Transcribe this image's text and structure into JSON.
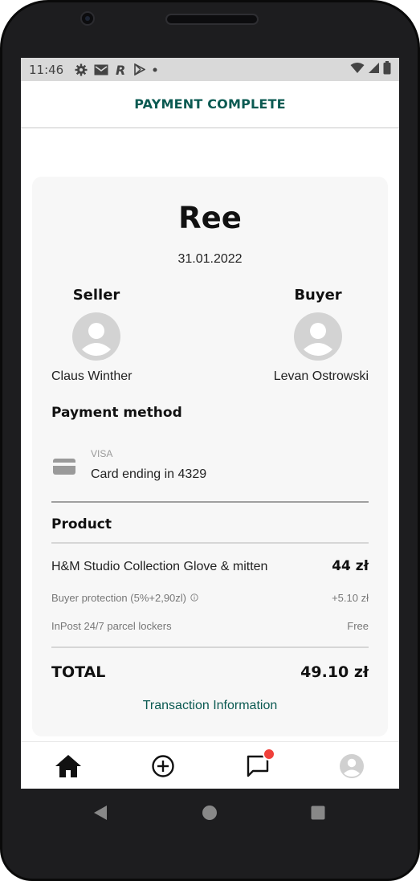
{
  "status_bar": {
    "time": "11:46",
    "icons": [
      "gear-icon",
      "gmail-icon",
      "r-app-icon",
      "play-store-icon",
      "dot-icon"
    ],
    "right_icons": [
      "wifi-icon",
      "signal-icon",
      "battery-icon"
    ]
  },
  "header": {
    "title": "PAYMENT COMPLETE"
  },
  "summary": {
    "store_name": "Ree",
    "date": "31.01.2022",
    "seller_label": "Seller",
    "seller_name": "Claus Winther",
    "buyer_label": "Buyer",
    "buyer_name": "Levan Ostrowski"
  },
  "payment": {
    "title": "Payment method",
    "card_brand": "VISA",
    "card_text": "Card ending in 4329",
    "icon": "credit-card-icon"
  },
  "product": {
    "title": "Product",
    "item_name": "H&M Studio Collection Glove & mitten",
    "item_price": "44 zł",
    "protection_label": "Buyer protection (5%+2,90zl)",
    "protection_value": "+5.10 zł",
    "shipping_label": "InPost 24/7 parcel lockers",
    "shipping_value": "Free"
  },
  "total": {
    "label": "TOTAL",
    "value": "49.10 zł"
  },
  "transaction_link": "Transaction Information",
  "bottom_nav": {
    "items": [
      "home-icon",
      "add-circle-icon",
      "chat-icon",
      "profile-icon"
    ],
    "chat_has_notification": true
  },
  "colors": {
    "accent": "#0b5a52",
    "notification": "#f0403a",
    "card_background": "#f7f7f7"
  }
}
